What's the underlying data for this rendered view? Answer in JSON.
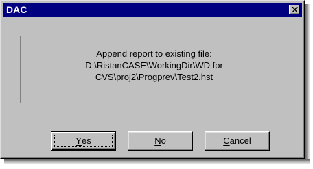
{
  "window": {
    "title": "DAC"
  },
  "message": {
    "line1": "Append report to existing file:",
    "line2": "D:\\RistanCASE\\WorkingDir\\WD for",
    "line3": "CVS\\proj2\\Progprev\\Test2.hst"
  },
  "buttons": {
    "yes": {
      "mnemonic": "Y",
      "rest": "es"
    },
    "no": {
      "mnemonic": "N",
      "rest": "o"
    },
    "cancel": {
      "mnemonic": "C",
      "rest": "ancel"
    }
  },
  "icons": {
    "close": "close-icon"
  }
}
